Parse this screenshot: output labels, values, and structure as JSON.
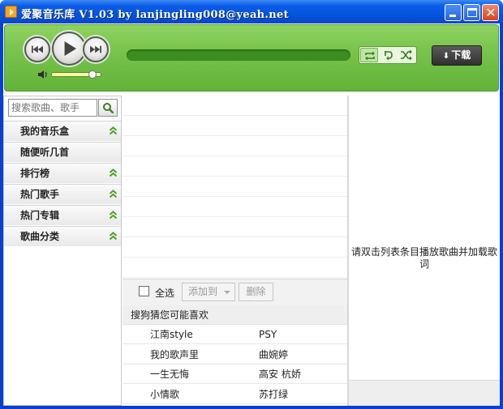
{
  "window": {
    "title": "爱聚音乐库 V1.03 by lanjingling008@yeah.net",
    "close_glyph": "✕"
  },
  "player": {
    "progress": 0.0,
    "volume": 0.85,
    "play_mode_active": "repeat-all",
    "download_label": "下载"
  },
  "sidebar": {
    "search_placeholder": "搜索歌曲、歌手",
    "items": [
      {
        "label": "我的音乐盒",
        "expandable": true
      },
      {
        "label": "随便听几首",
        "expandable": false
      },
      {
        "label": "排行榜",
        "expandable": true
      },
      {
        "label": "热门歌手",
        "expandable": true
      },
      {
        "label": "热门专辑",
        "expandable": true
      },
      {
        "label": "歌曲分类",
        "expandable": true
      }
    ]
  },
  "playlist": {
    "select_all_label": "全选",
    "add_to_label": "添加到",
    "delete_label": "删除"
  },
  "guess": {
    "header": "搜狗猜您可能喜欢",
    "rows": [
      {
        "song": "江南style",
        "artist": "PSY"
      },
      {
        "song": "我的歌声里",
        "artist": "曲婉婷"
      },
      {
        "song": "一生无悔",
        "artist": "高安 杭娇"
      },
      {
        "song": "小情歌",
        "artist": "苏打绿"
      }
    ]
  },
  "lyrics": {
    "hint": "请双击列表条目播放歌曲并加载歌词"
  },
  "colors": {
    "player_green": "#76c24a",
    "titlebar_blue": "#0552d9"
  }
}
